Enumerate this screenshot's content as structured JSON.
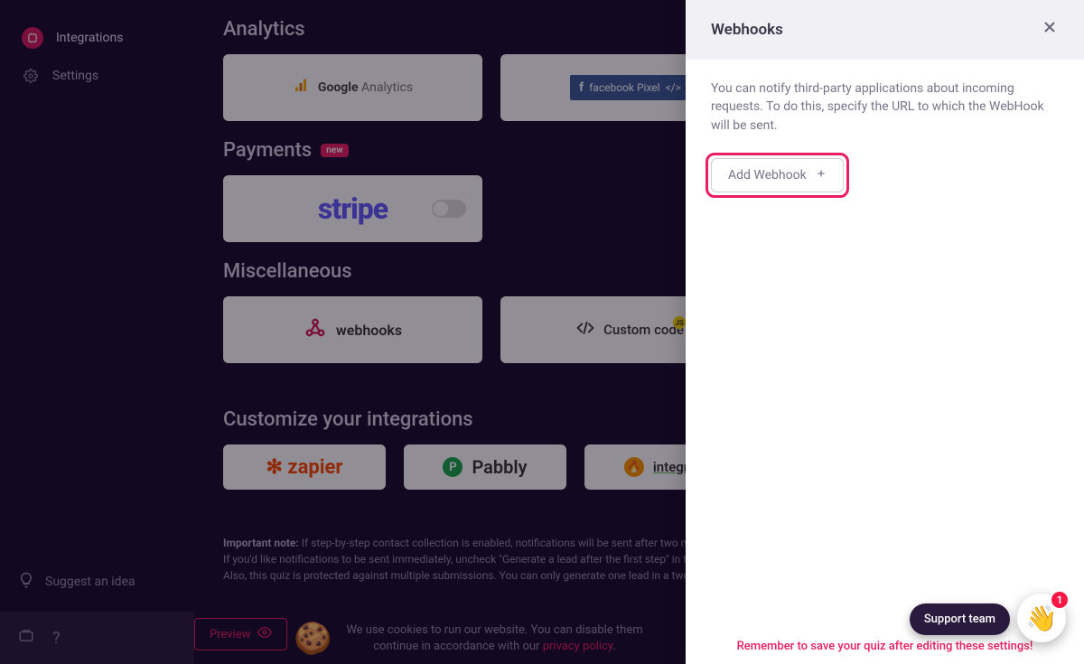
{
  "sidebar": {
    "items": [
      {
        "label": "Integrations",
        "icon": "puzzle"
      },
      {
        "label": "Settings",
        "icon": "gear"
      }
    ],
    "suggest_label": "Suggest an idea"
  },
  "main": {
    "analytics": {
      "title": "Analytics",
      "google_analytics": "Google Analytics",
      "facebook_pixel": "facebook Pixel",
      "fb_code": "</>"
    },
    "payments": {
      "title": "Payments",
      "badge": "new",
      "stripe": "stripe"
    },
    "misc": {
      "title": "Miscellaneous",
      "webhooks": "webhooks",
      "custom_code": "Custom code",
      "js_badge": "JS"
    },
    "customize": {
      "title": "Customize your integrations",
      "zapier": "zapier",
      "pabbly": "Pabbly",
      "integrately": "integrate"
    },
    "note": {
      "label": "Important note:",
      "line1": "If step-by-step contact collection is enabled, notifications will be sent after two minutes.",
      "line2": "If you'd like notifications to be sent immediately, uncheck \"Generate a lead after the first step\" in the \"Lead G",
      "line3": "Also, this quiz is protected against multiple submissions. You can only generate one lead in a two minute tim"
    },
    "preview_btn": "Preview",
    "cookie": {
      "text1": "We use cookies to run our website. You can disable them",
      "text2": "continue in accordance with our ",
      "link": "privacy policy",
      "dot": "."
    }
  },
  "panel": {
    "title": "Webhooks",
    "description": "You can notify third-party applications about incoming requests. To do this, specify the URL to which the WebHook will be sent.",
    "add_btn": "Add Webhook",
    "footer": "Remember to save your quiz after editing these settings!"
  },
  "support": {
    "pill": "Support team",
    "badge": "1"
  }
}
